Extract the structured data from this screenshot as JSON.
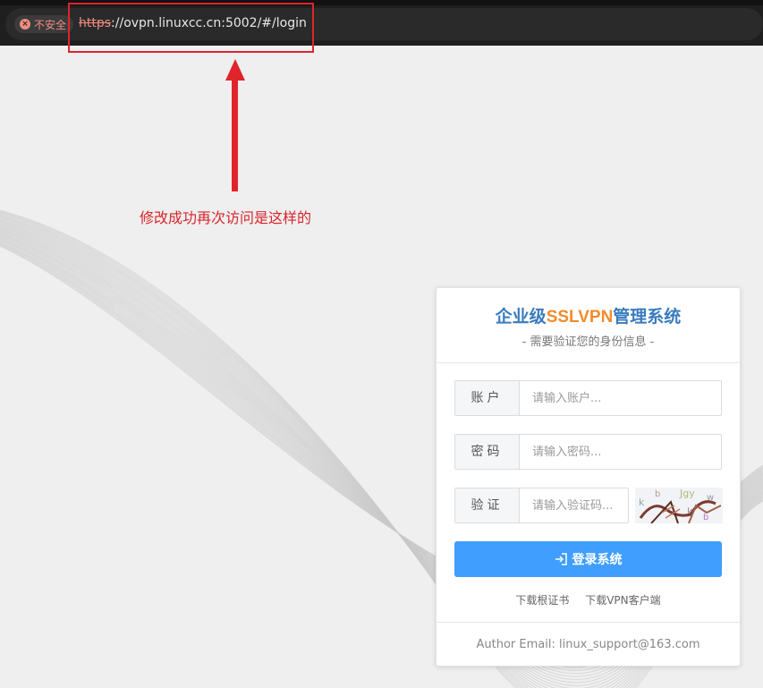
{
  "browser": {
    "insecure_label": "不安全",
    "url_scheme": "https",
    "url_rest": "://ovpn.linuxcc.cn:5002/#/login"
  },
  "annotation": {
    "text": "修改成功再次访问是这样的",
    "color": "#d9252b"
  },
  "login": {
    "title_prefix": "企业级",
    "title_accent": "SSLVPN",
    "title_suffix": "管理系统",
    "subtitle": "- 需要验证您的身份信息 -",
    "account_label": "账户",
    "account_placeholder": "请输入账户...",
    "password_label": "密码",
    "password_placeholder": "请输入密码...",
    "captcha_label": "验证",
    "captcha_placeholder": "请输入验证码...",
    "login_button": "登录系统",
    "link_cert": "下载根证书",
    "link_client": "下载VPN客户端",
    "footer": "Author Email: linux_support@163.com"
  },
  "colors": {
    "title_blue": "#3a7bbd",
    "title_orange": "#f08c2d",
    "button_blue": "#409eff"
  },
  "icons": {
    "insecure": "warning-circle-icon",
    "login": "sign-in-icon"
  }
}
